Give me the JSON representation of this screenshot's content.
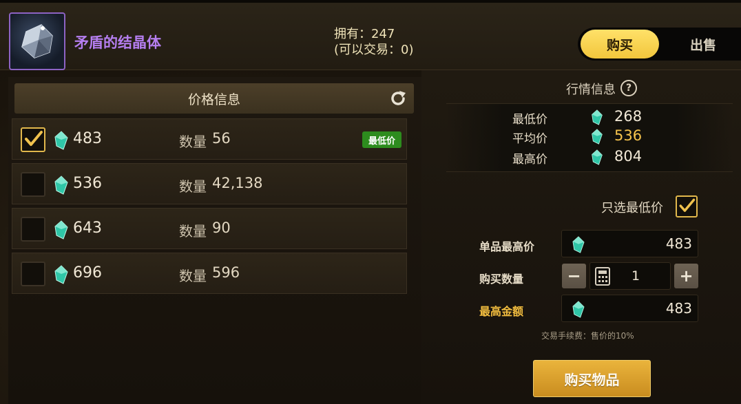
{
  "item": {
    "name": "矛盾的结晶体",
    "owned": "拥有：247",
    "tradable": "(可以交易：0)"
  },
  "mode_toggle": {
    "buy_label": "购买",
    "sell_label": "出售",
    "active": "buy"
  },
  "price_list": {
    "title": "价格信息",
    "qty_label": "数量",
    "lowest_badge": "最低价",
    "rows": [
      {
        "price": "483",
        "qty": "56",
        "checked": true
      },
      {
        "price": "536",
        "qty": "42,138",
        "checked": false
      },
      {
        "price": "643",
        "qty": "90",
        "checked": false
      },
      {
        "price": "696",
        "qty": "596",
        "checked": false
      }
    ]
  },
  "market_info": {
    "title": "行情信息",
    "min_label": "最低价",
    "min_value": "268",
    "avg_label": "平均价",
    "avg_value": "536",
    "max_label": "最高价",
    "max_value": "804"
  },
  "purchase_form": {
    "only_lowest_label": "只选最低价",
    "only_lowest_checked": true,
    "unit_max_label": "单品最高价",
    "unit_max_value": "483",
    "quantity_label": "购买数量",
    "quantity_value": "1",
    "total_max_label": "最高金额",
    "total_max_value": "483",
    "fee_note": "交易手续费：售价的10%",
    "buy_button": "购买物品"
  },
  "colors": {
    "item_name": "#b57ef0",
    "accent_gold": "#f2bd3f",
    "badge_green": "#2d8c1e",
    "gem": "#2fc6a7"
  },
  "icons": {
    "currency": "gem-icon",
    "refresh": "refresh-icon",
    "help": "help-icon",
    "calculator": "calculator-icon",
    "checkbox": "check-icon"
  }
}
